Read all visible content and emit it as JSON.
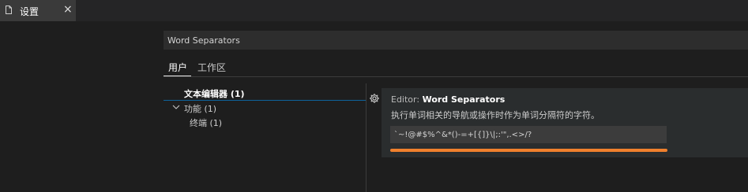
{
  "tabs": [
    {
      "label": "设置",
      "close_glyph": "×",
      "active": true
    }
  ],
  "search": {
    "value": "Word Separators"
  },
  "scope_tabs": [
    {
      "label": "用户",
      "active": true
    },
    {
      "label": "工作区",
      "active": false
    }
  ],
  "toc": {
    "text_editor": "文本编辑器 (1)",
    "features": "功能 (1)",
    "terminal": "终端 (1)"
  },
  "setting": {
    "category": "Editor: ",
    "key": "Word Separators",
    "description": "执行单词相关的导航或操作时作为单词分隔符的字符。",
    "value": "`~!@#$%^&*()-=+[{]}\\|;:'\",.<>/?"
  },
  "icons": {
    "tab": "file-icon",
    "features": "chevron-down-icon",
    "setting": "gear-icon"
  },
  "colors": {
    "focus_accent": "#f0802d",
    "toc_accent": "#0e639c"
  }
}
